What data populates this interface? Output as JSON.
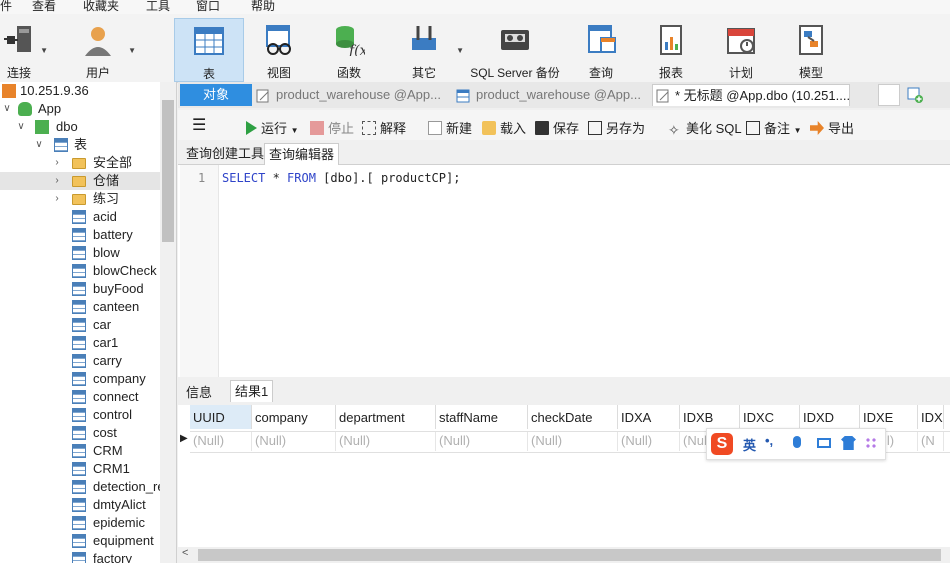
{
  "menu": [
    "件",
    "查看",
    "收藏夹",
    "工具",
    "窗口",
    "帮助"
  ],
  "toolbar": {
    "items": [
      {
        "label": "连接"
      },
      {
        "label": "用户"
      },
      {
        "label": "表"
      },
      {
        "label": "视图"
      },
      {
        "label": "函数"
      },
      {
        "label": "其它"
      },
      {
        "label": "SQL Server 备份"
      },
      {
        "label": "查询"
      },
      {
        "label": "报表"
      },
      {
        "label": "计划"
      },
      {
        "label": "模型"
      }
    ]
  },
  "sidebar": {
    "connection": "10.251.9.36",
    "database": "App",
    "schema": "dbo",
    "tables_group": "表",
    "folders": [
      "安全部",
      "仓储",
      "练习"
    ],
    "tables": [
      "acid",
      "battery",
      "blow",
      "blowCheck",
      "buyFood",
      "canteen",
      "car",
      "car1",
      "carry",
      "company",
      "connect",
      "control",
      "cost",
      "CRM",
      "CRM1",
      "detection_re",
      "dmtyAlict",
      "epidemic",
      "equipment",
      "factory"
    ]
  },
  "tabs": {
    "objects": "对象",
    "t1": "product_warehouse @App...",
    "t2": "product_warehouse @App...",
    "t3": "* 无标题 @App.dbo (10.251...."
  },
  "editor_toolbar": {
    "run": "运行",
    "stop": "停止",
    "explain": "解释",
    "new": "新建",
    "load": "载入",
    "save": "保存",
    "saveas": "另存为",
    "beautify": "美化 SQL",
    "note": "备注",
    "export": "导出"
  },
  "subtabs": {
    "builder": "查询创建工具",
    "editor": "查询编辑器"
  },
  "sql": {
    "line_no": "1",
    "kw1": "SELECT",
    "p1": " * ",
    "kw2": "FROM",
    "p2": " [dbo].[ productCP];"
  },
  "result_tabs": {
    "info": "信息",
    "result1": "结果1"
  },
  "grid": {
    "columns": [
      "UUID",
      "company",
      "department",
      "staffName",
      "checkDate",
      "IDXA",
      "IDXB",
      "IDXC",
      "IDXD",
      "IDXE",
      "IDX"
    ],
    "null_text": "(Null)",
    "nulls": [
      "(Null)",
      "(Null)",
      "(Null)",
      "(Null)",
      "(Null)",
      "(Null)",
      "(Null)",
      "(Null)",
      "(Null)",
      "(Null)",
      "(N"
    ]
  },
  "ime": {
    "lang": "英",
    "punct": "•,"
  },
  "colors": {
    "accent": "#2f8ee0",
    "keyword": "#2f44c9",
    "ime_logo": "#f04a23"
  }
}
